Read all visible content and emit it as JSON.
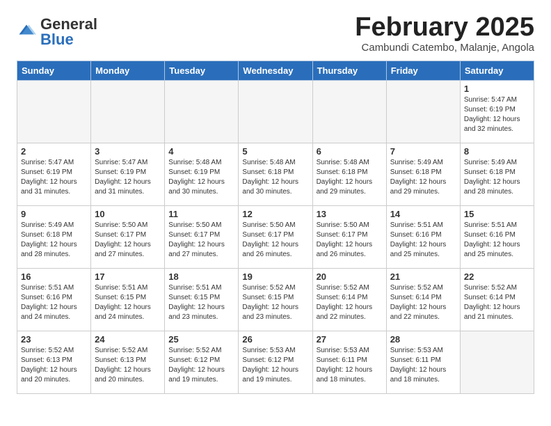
{
  "logo": {
    "general": "General",
    "blue": "Blue"
  },
  "header": {
    "month": "February 2025",
    "location": "Cambundi Catembo, Malanje, Angola"
  },
  "weekdays": [
    "Sunday",
    "Monday",
    "Tuesday",
    "Wednesday",
    "Thursday",
    "Friday",
    "Saturday"
  ],
  "weeks": [
    [
      {
        "day": "",
        "info": ""
      },
      {
        "day": "",
        "info": ""
      },
      {
        "day": "",
        "info": ""
      },
      {
        "day": "",
        "info": ""
      },
      {
        "day": "",
        "info": ""
      },
      {
        "day": "",
        "info": ""
      },
      {
        "day": "1",
        "info": "Sunrise: 5:47 AM\nSunset: 6:19 PM\nDaylight: 12 hours\nand 32 minutes."
      }
    ],
    [
      {
        "day": "2",
        "info": "Sunrise: 5:47 AM\nSunset: 6:19 PM\nDaylight: 12 hours\nand 31 minutes."
      },
      {
        "day": "3",
        "info": "Sunrise: 5:47 AM\nSunset: 6:19 PM\nDaylight: 12 hours\nand 31 minutes."
      },
      {
        "day": "4",
        "info": "Sunrise: 5:48 AM\nSunset: 6:19 PM\nDaylight: 12 hours\nand 30 minutes."
      },
      {
        "day": "5",
        "info": "Sunrise: 5:48 AM\nSunset: 6:18 PM\nDaylight: 12 hours\nand 30 minutes."
      },
      {
        "day": "6",
        "info": "Sunrise: 5:48 AM\nSunset: 6:18 PM\nDaylight: 12 hours\nand 29 minutes."
      },
      {
        "day": "7",
        "info": "Sunrise: 5:49 AM\nSunset: 6:18 PM\nDaylight: 12 hours\nand 29 minutes."
      },
      {
        "day": "8",
        "info": "Sunrise: 5:49 AM\nSunset: 6:18 PM\nDaylight: 12 hours\nand 28 minutes."
      }
    ],
    [
      {
        "day": "9",
        "info": "Sunrise: 5:49 AM\nSunset: 6:18 PM\nDaylight: 12 hours\nand 28 minutes."
      },
      {
        "day": "10",
        "info": "Sunrise: 5:50 AM\nSunset: 6:17 PM\nDaylight: 12 hours\nand 27 minutes."
      },
      {
        "day": "11",
        "info": "Sunrise: 5:50 AM\nSunset: 6:17 PM\nDaylight: 12 hours\nand 27 minutes."
      },
      {
        "day": "12",
        "info": "Sunrise: 5:50 AM\nSunset: 6:17 PM\nDaylight: 12 hours\nand 26 minutes."
      },
      {
        "day": "13",
        "info": "Sunrise: 5:50 AM\nSunset: 6:17 PM\nDaylight: 12 hours\nand 26 minutes."
      },
      {
        "day": "14",
        "info": "Sunrise: 5:51 AM\nSunset: 6:16 PM\nDaylight: 12 hours\nand 25 minutes."
      },
      {
        "day": "15",
        "info": "Sunrise: 5:51 AM\nSunset: 6:16 PM\nDaylight: 12 hours\nand 25 minutes."
      }
    ],
    [
      {
        "day": "16",
        "info": "Sunrise: 5:51 AM\nSunset: 6:16 PM\nDaylight: 12 hours\nand 24 minutes."
      },
      {
        "day": "17",
        "info": "Sunrise: 5:51 AM\nSunset: 6:15 PM\nDaylight: 12 hours\nand 24 minutes."
      },
      {
        "day": "18",
        "info": "Sunrise: 5:51 AM\nSunset: 6:15 PM\nDaylight: 12 hours\nand 23 minutes."
      },
      {
        "day": "19",
        "info": "Sunrise: 5:52 AM\nSunset: 6:15 PM\nDaylight: 12 hours\nand 23 minutes."
      },
      {
        "day": "20",
        "info": "Sunrise: 5:52 AM\nSunset: 6:14 PM\nDaylight: 12 hours\nand 22 minutes."
      },
      {
        "day": "21",
        "info": "Sunrise: 5:52 AM\nSunset: 6:14 PM\nDaylight: 12 hours\nand 22 minutes."
      },
      {
        "day": "22",
        "info": "Sunrise: 5:52 AM\nSunset: 6:14 PM\nDaylight: 12 hours\nand 21 minutes."
      }
    ],
    [
      {
        "day": "23",
        "info": "Sunrise: 5:52 AM\nSunset: 6:13 PM\nDaylight: 12 hours\nand 20 minutes."
      },
      {
        "day": "24",
        "info": "Sunrise: 5:52 AM\nSunset: 6:13 PM\nDaylight: 12 hours\nand 20 minutes."
      },
      {
        "day": "25",
        "info": "Sunrise: 5:52 AM\nSunset: 6:12 PM\nDaylight: 12 hours\nand 19 minutes."
      },
      {
        "day": "26",
        "info": "Sunrise: 5:53 AM\nSunset: 6:12 PM\nDaylight: 12 hours\nand 19 minutes."
      },
      {
        "day": "27",
        "info": "Sunrise: 5:53 AM\nSunset: 6:11 PM\nDaylight: 12 hours\nand 18 minutes."
      },
      {
        "day": "28",
        "info": "Sunrise: 5:53 AM\nSunset: 6:11 PM\nDaylight: 12 hours\nand 18 minutes."
      },
      {
        "day": "",
        "info": ""
      }
    ]
  ]
}
